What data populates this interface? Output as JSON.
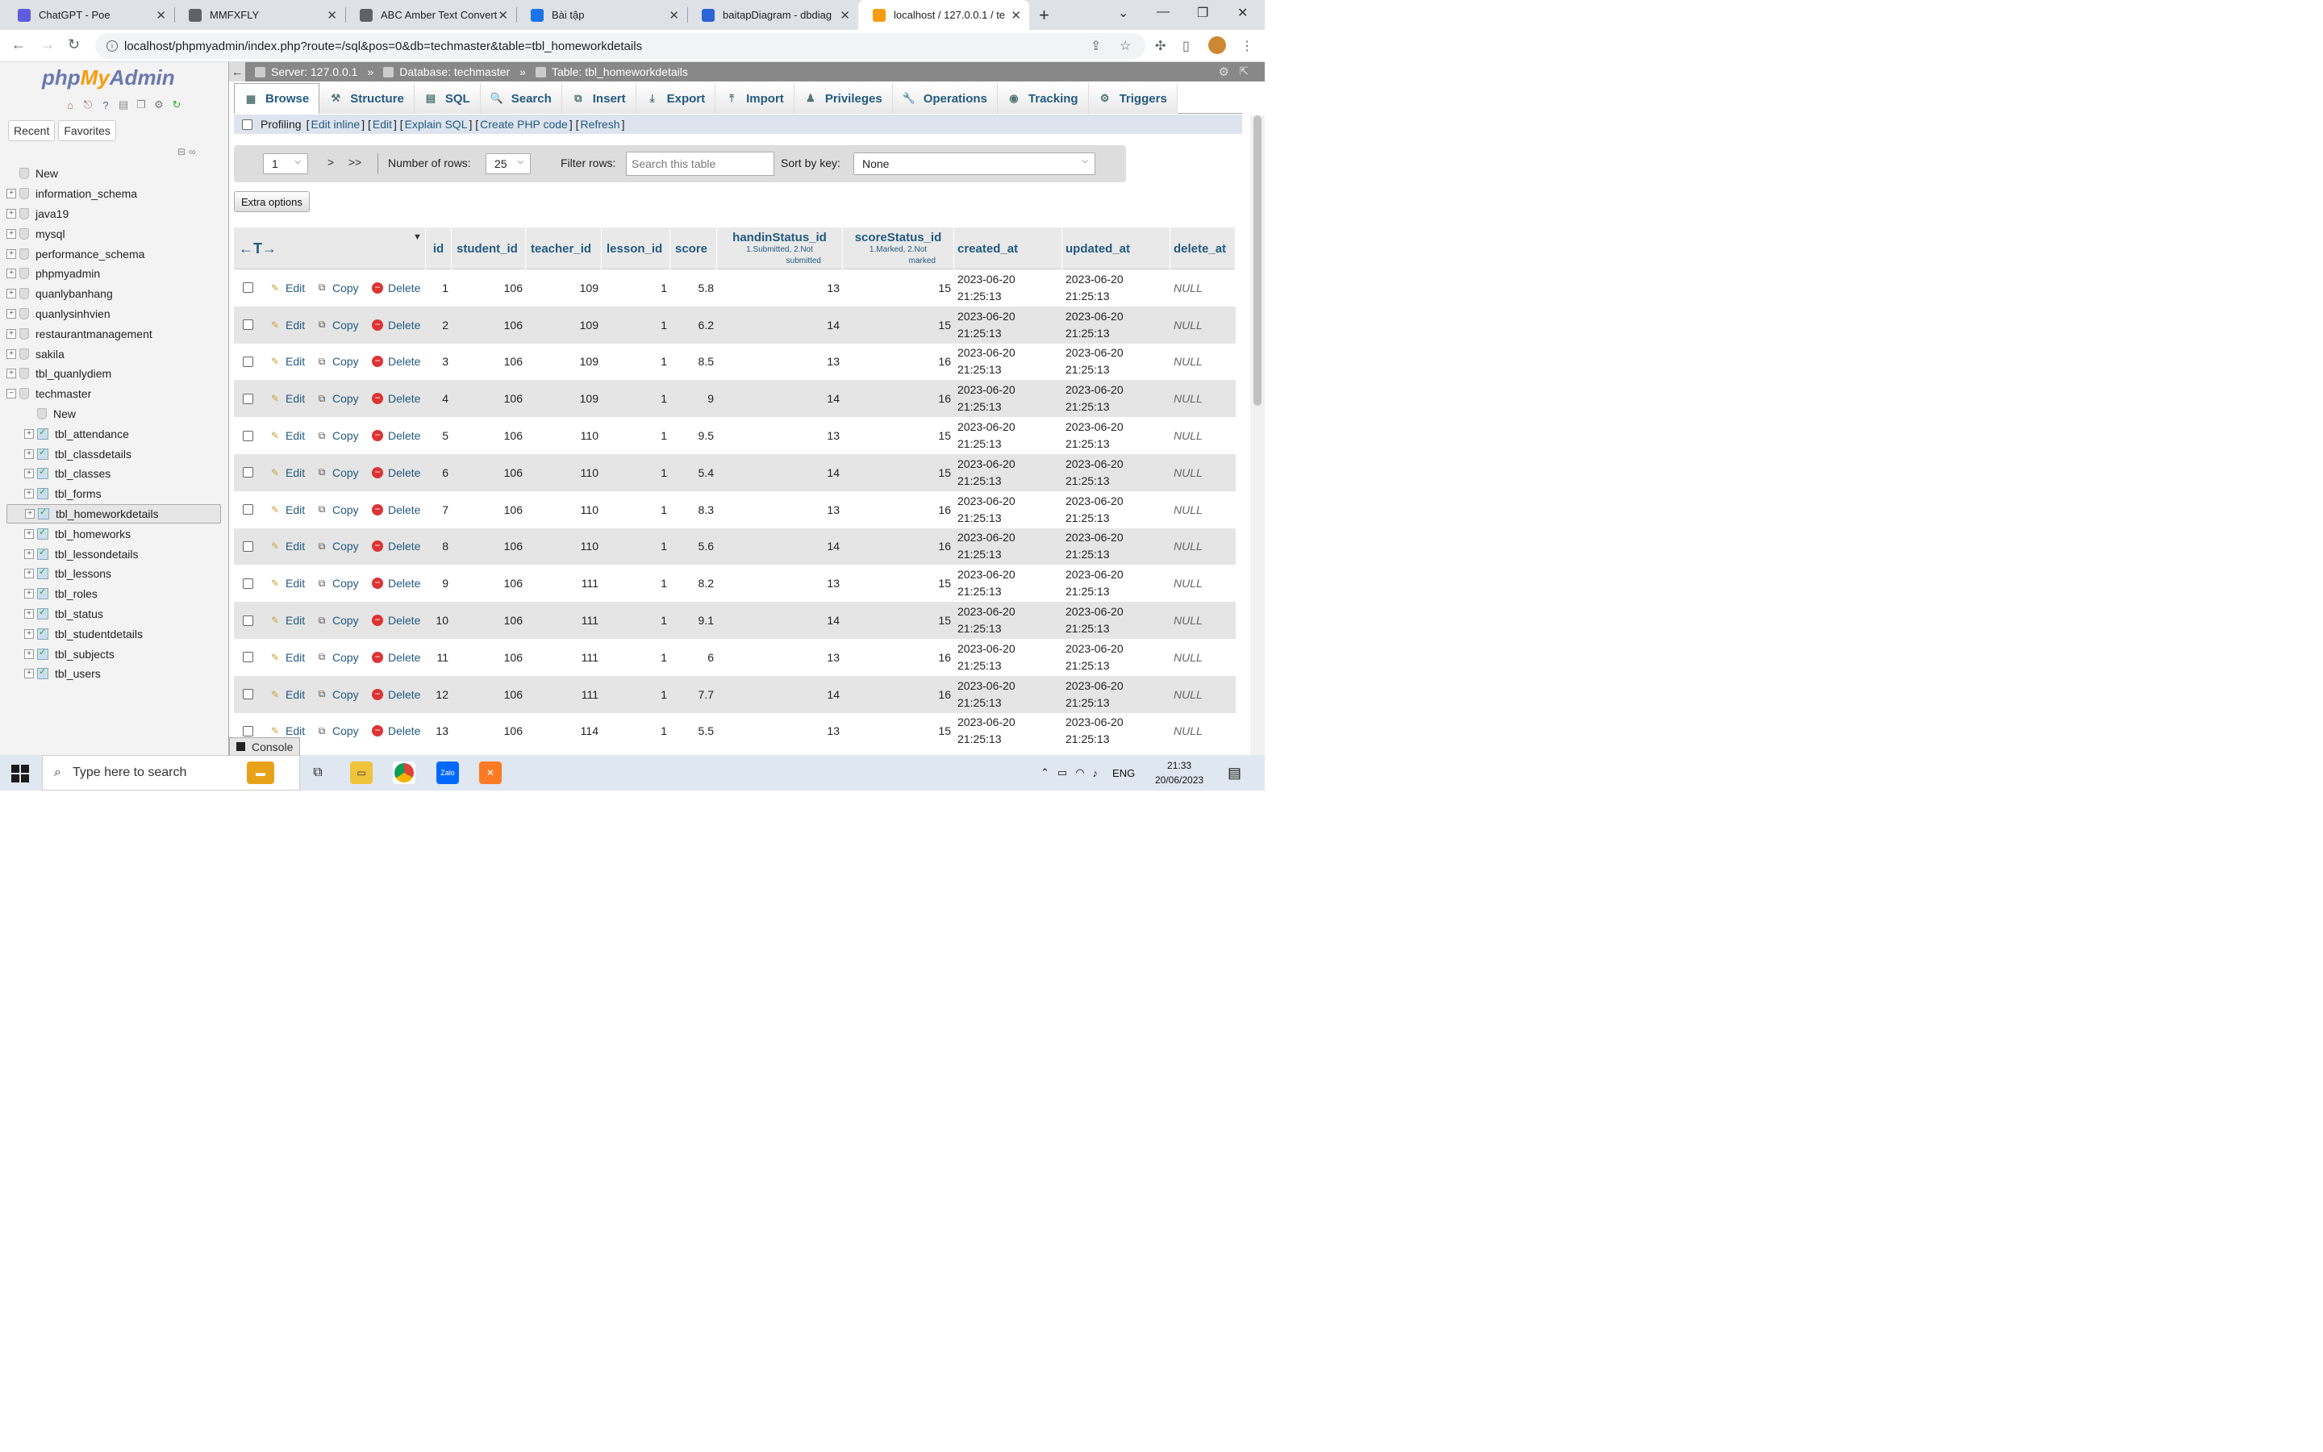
{
  "browser": {
    "tabs": [
      {
        "label": "ChatGPT - Poe",
        "color": "#5d5cde"
      },
      {
        "label": "MMFXFLY",
        "color": "#5f6368"
      },
      {
        "label": "ABC Amber Text Convert",
        "color": "#5f6368"
      },
      {
        "label": "Bài tập",
        "color": "#1a73e8"
      },
      {
        "label": "baitapDiagram - dbdiag",
        "color": "#2a64d6"
      },
      {
        "label": "localhost / 127.0.0.1 / te",
        "color": "#f89c0e"
      }
    ],
    "url": "localhost/phpmyadmin/index.php?route=/sql&pos=0&db=techmaster&table=tbl_homeworkdetails"
  },
  "sidebar": {
    "logo": {
      "php": "php",
      "my": "My",
      "admin": "Admin"
    },
    "tabs": [
      "Recent",
      "Favorites"
    ],
    "tree": [
      {
        "label": "New",
        "level": 0,
        "kind": "new"
      },
      {
        "label": "information_schema",
        "level": 0,
        "kind": "db"
      },
      {
        "label": "java19",
        "level": 0,
        "kind": "db"
      },
      {
        "label": "mysql",
        "level": 0,
        "kind": "db"
      },
      {
        "label": "performance_schema",
        "level": 0,
        "kind": "db"
      },
      {
        "label": "phpmyadmin",
        "level": 0,
        "kind": "db"
      },
      {
        "label": "quanlybanhang",
        "level": 0,
        "kind": "db"
      },
      {
        "label": "quanlysinhvien",
        "level": 0,
        "kind": "db"
      },
      {
        "label": "restaurantmanagement",
        "level": 0,
        "kind": "db"
      },
      {
        "label": "sakila",
        "level": 0,
        "kind": "db"
      },
      {
        "label": "tbl_quanlydiem",
        "level": 0,
        "kind": "db"
      },
      {
        "label": "techmaster",
        "level": 0,
        "kind": "db-open"
      },
      {
        "label": "New",
        "level": 1,
        "kind": "new"
      },
      {
        "label": "tbl_attendance",
        "level": 1,
        "kind": "table"
      },
      {
        "label": "tbl_classdetails",
        "level": 1,
        "kind": "table"
      },
      {
        "label": "tbl_classes",
        "level": 1,
        "kind": "table"
      },
      {
        "label": "tbl_forms",
        "level": 1,
        "kind": "table"
      },
      {
        "label": "tbl_homeworkdetails",
        "level": 1,
        "kind": "table",
        "selected": true
      },
      {
        "label": "tbl_homeworks",
        "level": 1,
        "kind": "table"
      },
      {
        "label": "tbl_lessondetails",
        "level": 1,
        "kind": "table"
      },
      {
        "label": "tbl_lessons",
        "level": 1,
        "kind": "table"
      },
      {
        "label": "tbl_roles",
        "level": 1,
        "kind": "table"
      },
      {
        "label": "tbl_status",
        "level": 1,
        "kind": "table"
      },
      {
        "label": "tbl_studentdetails",
        "level": 1,
        "kind": "table"
      },
      {
        "label": "tbl_subjects",
        "level": 1,
        "kind": "table"
      },
      {
        "label": "tbl_users",
        "level": 1,
        "kind": "table"
      }
    ]
  },
  "breadcrumb": {
    "server": "Server: 127.0.0.1",
    "database": "Database: techmaster",
    "table": "Table: tbl_homeworkdetails"
  },
  "menu": [
    "Browse",
    "Structure",
    "SQL",
    "Search",
    "Insert",
    "Export",
    "Import",
    "Privileges",
    "Operations",
    "Tracking",
    "Triggers"
  ],
  "profiling": {
    "label": "Profiling",
    "links": [
      "Edit inline",
      "Edit",
      "Explain SQL",
      "Create PHP code",
      "Refresh"
    ]
  },
  "nav": {
    "page": "1",
    "next": ">",
    "last": ">>",
    "rows_label": "Number of rows:",
    "rows_value": "25",
    "filter_label": "Filter rows:",
    "filter_placeholder": "Search this table",
    "sort_label": "Sort by key:",
    "sort_value": "None"
  },
  "extra_options": "Extra options",
  "table": {
    "actions": {
      "edit": "Edit",
      "copy": "Copy",
      "delete": "Delete"
    },
    "columns": {
      "id": "id",
      "student_id": "student_id",
      "teacher_id": "teacher_id",
      "lesson_id": "lesson_id",
      "score": "score",
      "handin": "handinStatus_id",
      "handin_sub1": "1.Submitted, 2.Not",
      "handin_sub2": "submitted",
      "scorest": "scoreStatus_id",
      "scorest_sub1": "1.Marked, 2.Not",
      "scorest_sub2": "marked",
      "created_at": "created_at",
      "updated_at": "updated_at",
      "delete_at": "delete_at"
    },
    "rows": [
      [
        "1",
        "106",
        "109",
        "1",
        "5.8",
        "13",
        "15"
      ],
      [
        "2",
        "106",
        "109",
        "1",
        "6.2",
        "14",
        "15"
      ],
      [
        "3",
        "106",
        "109",
        "1",
        "8.5",
        "13",
        "16"
      ],
      [
        "4",
        "106",
        "109",
        "1",
        "9",
        "14",
        "16"
      ],
      [
        "5",
        "106",
        "110",
        "1",
        "9.5",
        "13",
        "15"
      ],
      [
        "6",
        "106",
        "110",
        "1",
        "5.4",
        "14",
        "15"
      ],
      [
        "7",
        "106",
        "110",
        "1",
        "8.3",
        "13",
        "16"
      ],
      [
        "8",
        "106",
        "110",
        "1",
        "5.6",
        "14",
        "16"
      ],
      [
        "9",
        "106",
        "111",
        "1",
        "8.2",
        "13",
        "15"
      ],
      [
        "10",
        "106",
        "111",
        "1",
        "9.1",
        "14",
        "15"
      ],
      [
        "11",
        "106",
        "111",
        "1",
        "6",
        "13",
        "16"
      ],
      [
        "12",
        "106",
        "111",
        "1",
        "7.7",
        "14",
        "16"
      ],
      [
        "13",
        "106",
        "114",
        "1",
        "5.5",
        "13",
        "15"
      ]
    ],
    "date": "2023-06-20",
    "time": "21:25:13",
    "null": "NULL"
  },
  "console": "Console",
  "taskbar": {
    "search": "Type here to search",
    "lang": "ENG",
    "time": "21:33",
    "date": "20/06/2023"
  }
}
